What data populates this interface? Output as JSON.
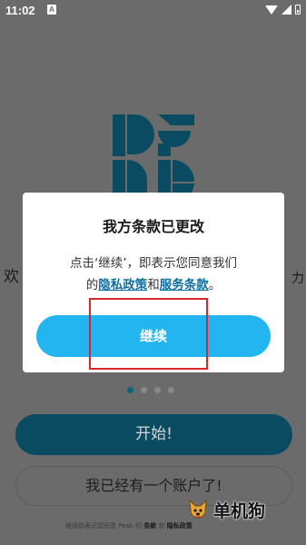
{
  "status_bar": {
    "time": "11:02",
    "notification_badge": "A"
  },
  "background": {
    "side_left_text": "欢",
    "side_right_text": "力",
    "pager": {
      "count": 4,
      "active_index": 0
    },
    "start_button_label": "开始!",
    "has_account_button_label": "我已经有一个账户了!",
    "footer": {
      "prefix": "继续即表示您同意 Peak 的",
      "terms": "条款",
      "conjunction": "和",
      "privacy": "隐私政策"
    }
  },
  "dialog": {
    "title": "我方条款已更改",
    "body_line1": "点击‘继续’，即表示您同意我们",
    "body_prefix": "的",
    "privacy_link": "隐私政策",
    "body_and": "和",
    "terms_link": "服务条款",
    "body_suffix": "。",
    "continue_label": "继续"
  },
  "watermark": {
    "text": "单机狗"
  },
  "colors": {
    "accent": "#22b5ef",
    "link": "#0e6ea3",
    "start_button": "#0a4b61",
    "highlight_box": "#d8262b"
  }
}
